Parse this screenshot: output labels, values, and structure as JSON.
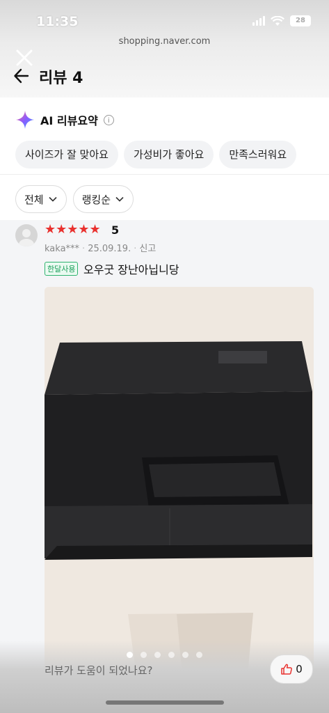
{
  "status": {
    "time": "11:35",
    "battery": "28"
  },
  "browser": {
    "url": "shopping.naver.com"
  },
  "header": {
    "title": "리뷰 4"
  },
  "ai_summary": {
    "title": "AI 리뷰요약",
    "info": "i",
    "chips": [
      "사이즈가 잘 맞아요",
      "가성비가 좋아요",
      "만족스러워요"
    ]
  },
  "filters": {
    "all": "전체",
    "sort": "랭킹순"
  },
  "review": {
    "stars": "★★★★★",
    "score": "5",
    "user": "kaka***",
    "date": "25.09.19.",
    "report": "신고",
    "badge": "한달사용",
    "text": "오우굿  장난아닙니당",
    "photo_count": 6,
    "photo_index": 1
  },
  "footer": {
    "question": "리뷰가 도움이 되었나요?",
    "likes": "0"
  },
  "colors": {
    "star": "#e9312e",
    "badge": "#1a9f5a"
  }
}
